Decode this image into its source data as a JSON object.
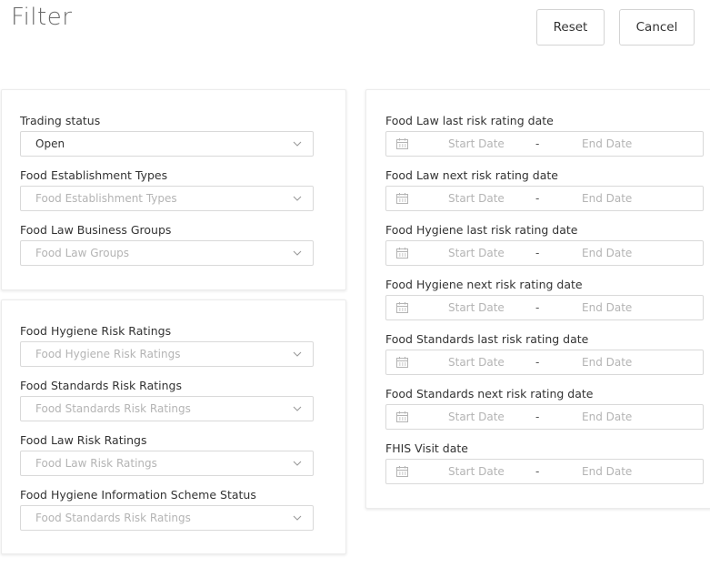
{
  "header": {
    "title": "Filter",
    "reset_label": "Reset",
    "cancel_label": "Cancel"
  },
  "business_panel": {
    "fields": [
      {
        "label": "Trading status",
        "value": "Open",
        "placeholder": ""
      },
      {
        "label": "Food Establishment Types",
        "value": "",
        "placeholder": "Food Establishment Types"
      },
      {
        "label": "Food Law Business Groups",
        "value": "",
        "placeholder": "Food Law Groups"
      }
    ]
  },
  "ratings_panel": {
    "fields": [
      {
        "label": "Food Hygiene Risk Ratings",
        "value": "",
        "placeholder": "Food Hygiene Risk Ratings"
      },
      {
        "label": "Food Standards Risk Ratings",
        "value": "",
        "placeholder": "Food Standards Risk Ratings"
      },
      {
        "label": "Food Law Risk Ratings",
        "value": "",
        "placeholder": "Food Law Risk Ratings"
      },
      {
        "label": "Food Hygiene Information Scheme Status",
        "value": "",
        "placeholder": "Food Standards Risk Ratings"
      }
    ]
  },
  "dates_panel": {
    "start_placeholder": "Start Date",
    "end_placeholder": "End Date",
    "separator": "-",
    "fields": [
      {
        "label": "Food Law last risk rating date"
      },
      {
        "label": "Food Law next risk rating date"
      },
      {
        "label": "Food Hygiene last risk rating date"
      },
      {
        "label": "Food Hygiene next risk rating date"
      },
      {
        "label": "Food Standards last risk rating date"
      },
      {
        "label": "Food Standards next risk rating date"
      },
      {
        "label": "FHIS Visit date"
      }
    ]
  },
  "icons": {
    "select_arrow": "chevron-down-icon",
    "date_picker": "calendar-icon"
  }
}
